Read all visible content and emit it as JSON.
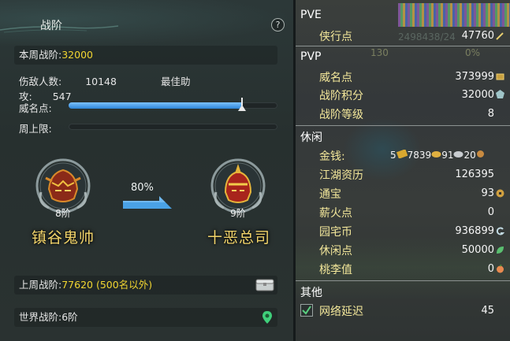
{
  "left_panel": {
    "title": "战阶",
    "help": "?",
    "week_rank": {
      "label": "本周战阶:",
      "value": "32000"
    },
    "injured": {
      "label": "伤敌人数:",
      "value": "10148"
    },
    "assist": {
      "label": "最佳助攻:",
      "value": "547"
    },
    "fame": {
      "label": "威名点:",
      "progress": 0.83
    },
    "weekly_cap": {
      "label": "周上限:",
      "progress": 0
    },
    "current_rank": {
      "tier": "8阶",
      "name": "镇谷鬼帅"
    },
    "progress_pct": "80%",
    "next_rank": {
      "tier": "9阶",
      "name": "十恶总司"
    },
    "last_week": {
      "label": "上周战阶:",
      "value": "77620 (500名以外)"
    },
    "world": {
      "label": "世界战阶:",
      "value": "6阶"
    }
  },
  "right_panel": {
    "pve": {
      "title": "PVE",
      "items": [
        {
          "label": "侠行点",
          "value": "47760"
        }
      ]
    },
    "pvp": {
      "title": "PVP",
      "items": [
        {
          "label": "威名点",
          "value": "373999"
        },
        {
          "label": "战阶积分",
          "value": "32000"
        },
        {
          "label": "战阶等级",
          "value": "8"
        }
      ]
    },
    "leisure": {
      "title": "休闲",
      "money": {
        "label": "金钱:",
        "gold_ingot": "5",
        "gold": "7839",
        "silver": "91",
        "copper": "20"
      },
      "items": [
        {
          "label": "江湖资历",
          "value": "126395"
        },
        {
          "label": "通宝",
          "value": "93"
        },
        {
          "label": "薪火点",
          "value": "0"
        },
        {
          "label": "园宅币",
          "value": "936899"
        },
        {
          "label": "休闲点",
          "value": "50000"
        },
        {
          "label": "桃李值",
          "value": "0"
        }
      ]
    },
    "other": {
      "title": "其他",
      "items": [
        {
          "label": "网络延迟",
          "value": "45",
          "checked": true
        }
      ]
    },
    "background_text": {
      "bg1": "2498438/24",
      "bg2": "130",
      "bg3": "0%"
    }
  },
  "colors": {
    "accent_yellow": "#f1d531",
    "bar_blue": "#3c92e0",
    "label_gold": "#f3e79a"
  }
}
